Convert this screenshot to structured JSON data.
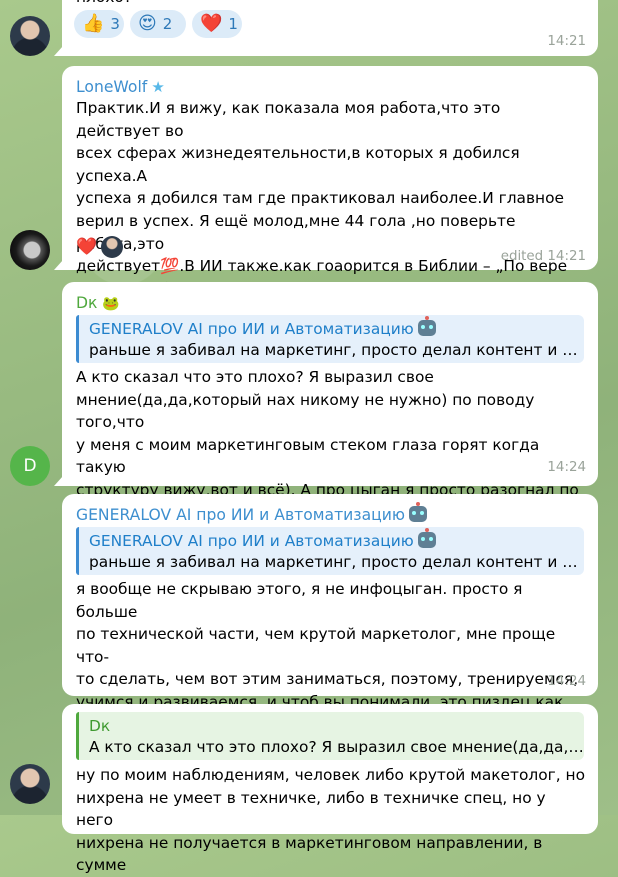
{
  "messages": [
    {
      "top_text": "плохо?",
      "reactions": [
        {
          "emoji": "👍",
          "count": "3"
        },
        {
          "emoji": "😍",
          "count": "2"
        },
        {
          "emoji": "❤️",
          "count": "1"
        }
      ],
      "time": "14:21"
    },
    {
      "sender": "LoneWolf",
      "sender_badge": "★",
      "text": "Практик.И я вижу, как показала моя  работа,что это действует во\nвсех сферах жизнедеятельности,в которых я добился успеха.А\nуспеха я добился там где практиковал наиболее.И главное\nверил в успех. Я ещё молод,мне 44 гола ,но поверьте ребята,это\nдействует💯.В ИИ также.как гоаорится в Библии – „По вере\nВашей да будет Вам !“",
      "reaction": "❤️",
      "time": "edited 14:21"
    },
    {
      "sender": "Dк",
      "sender_emoji": "🐸",
      "avatar_letter": "D",
      "reply_title": "GENERALOV AI про ИИ и Автоматизацию",
      "reply_text": "раньше я забивал на маркетинг, просто делал контент и клу...",
      "text": "А кто сказал что это плохо? Я выразил свое\nмнение(да,да,который нах никому не нужно) по поводу того,что\nу меня с моим маркетинговым стеком глаза горят когда такую\nструктуру вижу,вот и всё). А про цыган я просто разогнал по\nприколу😎 цыгане всегда збс тема для разгона",
      "time": "14:24"
    },
    {
      "sender": "GENERALOV AI про ИИ и Автоматизацию",
      "reply_title": "GENERALOV AI про ИИ и Автоматизацию",
      "reply_text": "раньше я забивал на маркетинг, просто делал контент и клу...",
      "text": "я вообще не скрываю этого, я не инфоцыган. просто я больше\nпо технической части, чем крутой маркетолог, мне проще что-\nто сделать, чем вот этим заниматься, поэтому, тренируемся,\nучимся и развиваемся. и чтоб вы понимали, это пиздец как\nтяжко, абсолютно неизведанный для меня мир 😁",
      "time": "14:24"
    },
    {
      "reply_title": "Dк",
      "reply_text": "А кто сказал что это плохо? Я выразил свое мнение(да,да,кот...",
      "text": "ну по моим наблюдениям, человек либо крутой макетолог, но\nнихрена не умеет в техничке, либо в техничке спец, но у него\nнихрена не получается в маркетинговом направлении, в сумме"
    }
  ]
}
